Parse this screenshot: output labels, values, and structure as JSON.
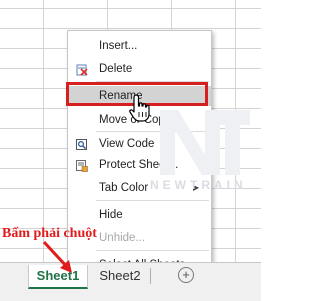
{
  "context_menu": {
    "items": [
      {
        "label": "Insert...",
        "icon": "none",
        "disabled": false
      },
      {
        "label": "Delete",
        "icon": "delete-sheet-icon",
        "disabled": false
      },
      {
        "label": "Rename",
        "icon": "none",
        "disabled": false,
        "highlighted": true
      },
      {
        "label": "Move or Copy...",
        "icon": "none",
        "disabled": false
      },
      {
        "label": "View Code",
        "icon": "view-code-icon",
        "disabled": false
      },
      {
        "label": "Protect Sheet...",
        "icon": "protect-sheet-icon",
        "disabled": false
      },
      {
        "label": "Tab Color",
        "icon": "none",
        "disabled": false,
        "submenu": true
      },
      {
        "label": "Hide",
        "icon": "none",
        "disabled": false
      },
      {
        "label": "Unhide...",
        "icon": "none",
        "disabled": true
      },
      {
        "label": "Select All Sheets",
        "icon": "none",
        "disabled": false
      }
    ],
    "highlight_color": "#d62020"
  },
  "sheet_tabs": {
    "tabs": [
      {
        "label": "Sheet1",
        "active": true
      },
      {
        "label": "Sheet2",
        "active": false
      }
    ],
    "add_button": "+",
    "active_color": "#217346"
  },
  "annotation": {
    "text": "Bấm phải chuột",
    "color": "#e11b1b"
  },
  "watermark": {
    "text": "NEWTRAIN"
  }
}
